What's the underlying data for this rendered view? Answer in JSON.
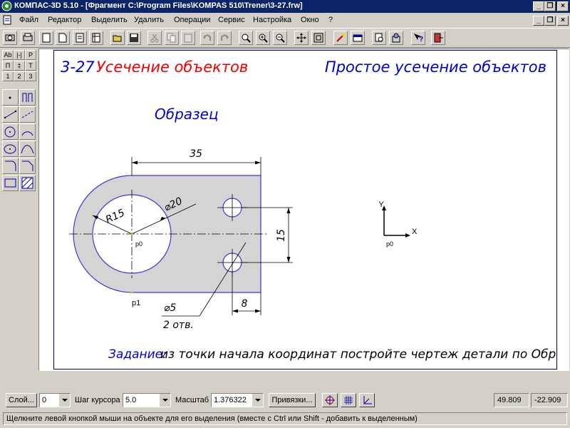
{
  "window": {
    "title": "КОМПАС-3D 5.10 - [Фрагмент C:\\Program Files\\KOMPAS 510\\Trener\\3-27.frw]",
    "minimize_glyph": "_",
    "maximize_glyph": "❐",
    "close_glyph": "×"
  },
  "menu": {
    "items": [
      "Файл",
      "Редактор",
      "Выделить",
      "Удалить",
      "Операции",
      "Сервис",
      "Настройка",
      "Окно",
      "?"
    ]
  },
  "toolbar": {
    "buttons": [
      "print-preview-icon",
      "print-icon",
      "new-sheet-icon",
      "new-fragment-icon",
      "new-document-icon",
      "new-spec-icon",
      "open-icon",
      "save-icon",
      "cut-icon",
      "copy-icon",
      "paste-icon",
      "undo-icon",
      "redo-icon",
      "zoom-icon",
      "zoom-in-icon",
      "zoom-out-icon",
      "pan-icon",
      "zoom-fit-icon",
      "regenerate-icon",
      "properties-icon",
      "view-icon",
      "parameters-icon",
      "help-icon",
      "exit-icon"
    ]
  },
  "left_panel": {
    "small_labels": [
      "Ab",
      "|-|",
      "P",
      "П",
      "‡",
      "T",
      "1",
      "2",
      "3"
    ]
  },
  "drawing": {
    "lesson_number": "3-27",
    "lesson_title": "Усечение объектов",
    "section_title": "Простое усечение объектов",
    "sample_label": "Образец",
    "dim_width": "35",
    "dim_radius": "R15",
    "dim_diameter_big": "⌀20",
    "dim_diameter_small": "⌀5",
    "dim_holes_count": "2 отв.",
    "dim_spacing": "15",
    "dim_offset": "8",
    "point_p0": "р0",
    "point_p1": "р1",
    "axis_x": "X",
    "axis_y": "Y",
    "axis_origin": "р0",
    "task_label": "Задание:",
    "task_text": "из точки начала координат постройте чертеж детали по Образцу."
  },
  "statusbar": {
    "layer_button": "Слой...",
    "layer_value": "0",
    "step_label": "Шаг курсора",
    "step_value": "5.0",
    "scale_label": "Масштаб",
    "scale_value": "1.376322",
    "snaps_button": "Привязки...",
    "coord_x": "49.809",
    "coord_y": "-22.909"
  },
  "hint": {
    "text": "Щелкните левой кнопкой мыши на объекте для его выделения (вместе с Ctrl или Shift - добавить к выделенным)"
  },
  "colors": {
    "title_blue": "#0a246a",
    "drawing_blue": "#0000cc",
    "drawing_red": "#ee0000",
    "part_fill": "#d4d4d4",
    "outline": "#3a3ad0"
  }
}
